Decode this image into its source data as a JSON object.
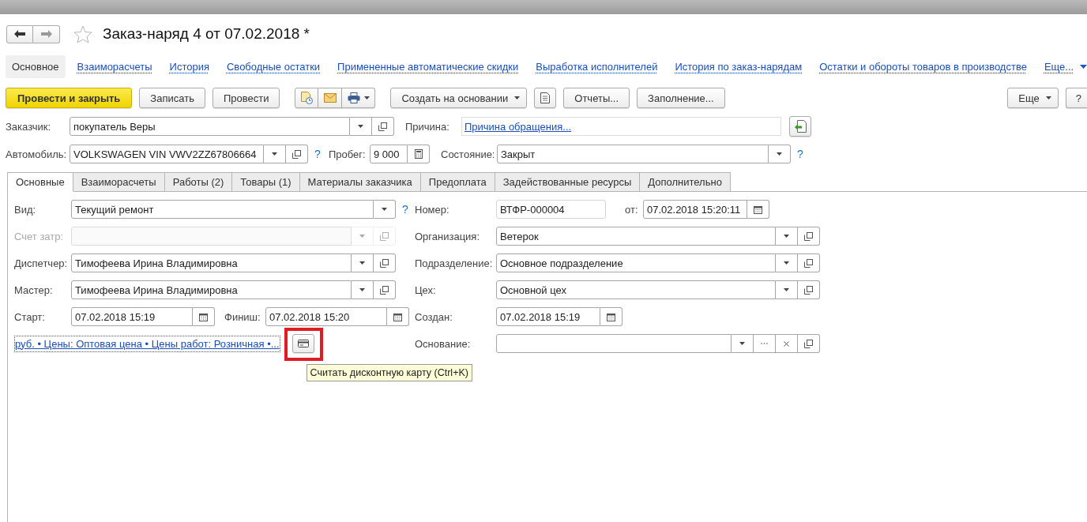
{
  "title": "Заказ-наряд 4 от 07.02.2018 *",
  "favorite": false,
  "sections": [
    {
      "label": "Основное",
      "selected": true
    },
    {
      "label": "Взаиморасчеты",
      "selected": false
    },
    {
      "label": "История",
      "selected": false
    },
    {
      "label": "Свободные остатки",
      "selected": false
    },
    {
      "label": "Примененные автоматические скидки",
      "selected": false
    },
    {
      "label": "Выработка исполнителей",
      "selected": false
    },
    {
      "label": "История по заказ-нарядам",
      "selected": false
    },
    {
      "label": "Остатки и обороты товаров в производстве",
      "selected": false
    }
  ],
  "sections_more": "Еще...",
  "toolbar": {
    "post_close": "Провести и закрыть",
    "save": "Записать",
    "post": "Провести",
    "create_based": "Создать на основании",
    "reports": "Отчеты...",
    "fill": "Заполнение...",
    "more": "Еще",
    "help": "?"
  },
  "customer": {
    "label": "Заказчик:",
    "value": "покупатель Веры",
    "kind": "select"
  },
  "reason": {
    "label": "Причина:",
    "link": "Причина обращения..."
  },
  "car": {
    "label": "Автомобиль:",
    "value": "VOLKSWAGEN VIN VWV2ZZ67806664",
    "kind": "select",
    "help": "?"
  },
  "mileage": {
    "label": "Пробег:",
    "value": "9 000",
    "kind": "number"
  },
  "state": {
    "label": "Состояние:",
    "value": "Закрыт",
    "kind": "combo",
    "help": "?"
  },
  "tabs": [
    {
      "label": "Основные",
      "selected": true
    },
    {
      "label": "Взаиморасчеты",
      "selected": false
    },
    {
      "label": "Работы (2)",
      "selected": false
    },
    {
      "label": "Товары (1)",
      "selected": false
    },
    {
      "label": "Материалы заказчика",
      "selected": false
    },
    {
      "label": "Предоплата",
      "selected": false
    },
    {
      "label": "Задействованные ресурсы",
      "selected": false
    },
    {
      "label": "Дополнительно",
      "selected": false
    }
  ],
  "left_fields": [
    {
      "label": "Вид:",
      "value": "Текущий ремонт",
      "kind": "combo",
      "help": "?",
      "disabled": false
    },
    {
      "label": "Счет затр:",
      "kind": "select",
      "disabled": true
    },
    {
      "label": "Диспетчер:",
      "value": "Тимофеева Ирина Владимировна",
      "kind": "select",
      "disabled": false
    },
    {
      "label": "Мастер:",
      "value": "Тимофеева Ирина Владимировна",
      "kind": "select",
      "disabled": false
    }
  ],
  "start": {
    "label": "Старт:",
    "value": "07.02.2018 15:19",
    "kind": "date"
  },
  "finish": {
    "label": "Финиш:",
    "value": "07.02.2018 15:20",
    "kind": "date"
  },
  "prices_link": "руб. • Цены: Оптовая цена • Цены работ: Розничная •...",
  "card_tooltip": "Считать дисконтную карту (Ctrl+K)",
  "number": {
    "label": "Номер:",
    "value": "ВТФР-000004"
  },
  "number_date": {
    "label": "от:",
    "value": "07.02.2018 15:20:11",
    "kind": "date"
  },
  "right_fields": [
    {
      "label": "Организация:",
      "value": "Ветерок",
      "kind": "select"
    },
    {
      "label": "Подразделение:",
      "value": "Основное подразделение",
      "kind": "select"
    },
    {
      "label": "Цех:",
      "value": "Основной цех",
      "kind": "select"
    },
    {
      "label": "Создан:",
      "value": "07.02.2018 15:19",
      "kind": "date"
    },
    {
      "label": "Основание:",
      "kind": "reference"
    }
  ]
}
